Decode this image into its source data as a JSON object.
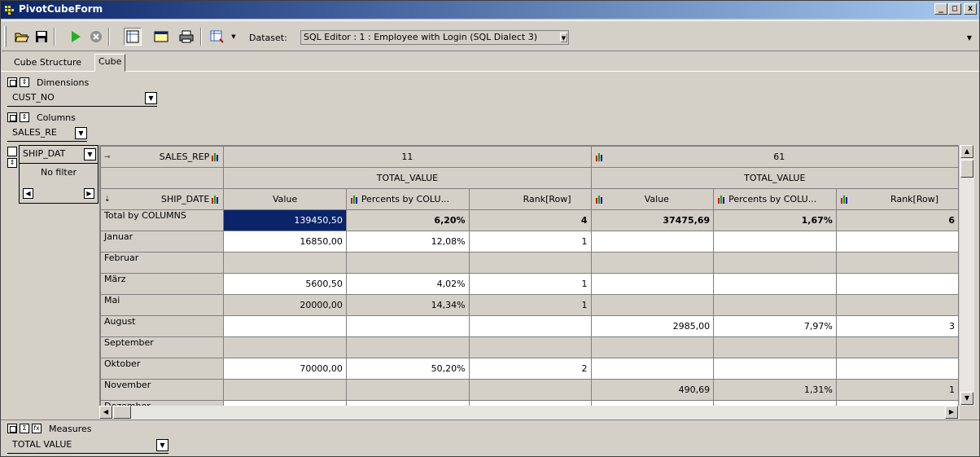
{
  "window": {
    "title": "PivotCubeForm",
    "minimize": "_",
    "maximize": "□",
    "close": "x"
  },
  "toolbar": {
    "buttons": [
      "open-folder-icon",
      "save-icon",
      "run-icon",
      "stop-icon",
      "structure-icon",
      "window-icon",
      "print-icon",
      "export-icon"
    ],
    "dataset_label": "Dataset:",
    "dataset_value": "SQL Editor : 1 : Employee with Login (SQL Dialect 3)"
  },
  "tabs": [
    {
      "label": "Cube Structure",
      "active": false
    },
    {
      "label": "Cube",
      "active": true
    }
  ],
  "dimensions": {
    "caption": "Dimensions",
    "field": "CUST_NO"
  },
  "columns": {
    "caption": "Columns",
    "field": "SALES_RE"
  },
  "rows_filter": {
    "field": "SHIP_DAT",
    "filter_text": "No filter"
  },
  "grid": {
    "col_dim_label": "SALES_REP",
    "row_dim_label": "SHIP_DATE",
    "groups": [
      {
        "key": "11",
        "measure": "TOTAL_VALUE"
      },
      {
        "key": "61",
        "measure": "TOTAL_VALUE"
      }
    ],
    "subcols": [
      "Value",
      "Percents by COLU...",
      "Rank[Row]"
    ],
    "rows": [
      {
        "label": "Total by COLUMNS",
        "cells": [
          "139450,50",
          "6,20%",
          "4",
          "37475,69",
          "1,67%",
          "6"
        ]
      },
      {
        "label": "Januar",
        "cells": [
          "16850,00",
          "12,08%",
          "1",
          "",
          "",
          ""
        ]
      },
      {
        "label": "Februar",
        "cells": [
          "",
          "",
          "",
          "",
          "",
          ""
        ]
      },
      {
        "label": "März",
        "cells": [
          "5600,50",
          "4,02%",
          "1",
          "",
          "",
          ""
        ]
      },
      {
        "label": "Mai",
        "cells": [
          "20000,00",
          "14,34%",
          "1",
          "",
          "",
          ""
        ]
      },
      {
        "label": "August",
        "cells": [
          "",
          "",
          "",
          "2985,00",
          "7,97%",
          "3"
        ]
      },
      {
        "label": "September",
        "cells": [
          "",
          "",
          "",
          "",
          "",
          ""
        ]
      },
      {
        "label": "Oktober",
        "cells": [
          "70000,00",
          "50,20%",
          "2",
          "",
          "",
          ""
        ]
      },
      {
        "label": "November",
        "cells": [
          "",
          "",
          "",
          "490,69",
          "1,31%",
          "1"
        ]
      },
      {
        "label": "Dezember",
        "cells": [
          "",
          "",
          "",
          "",
          "",
          ""
        ]
      }
    ]
  },
  "measures": {
    "caption": "Measures",
    "field": "TOTAL VALUE"
  }
}
